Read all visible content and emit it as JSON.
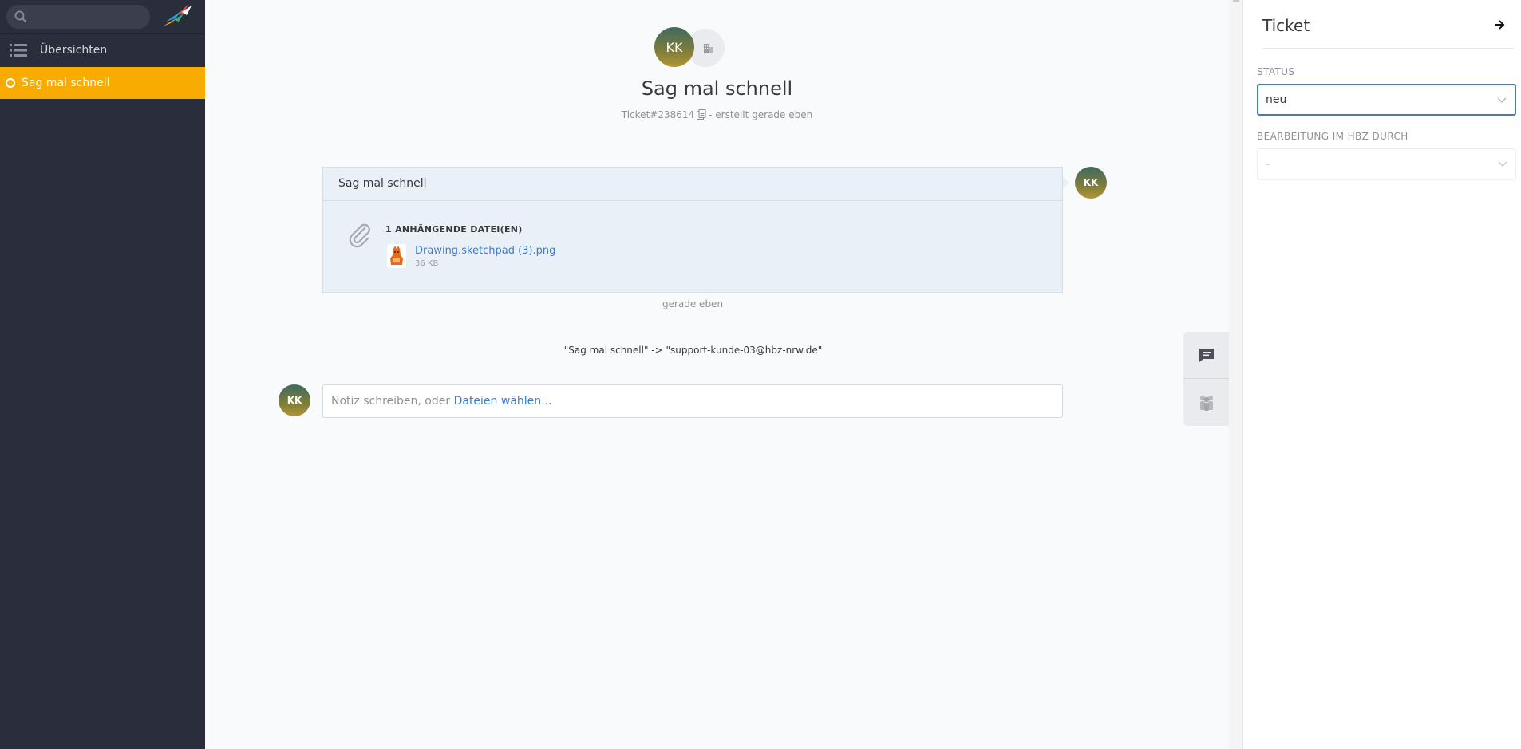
{
  "sidebar": {
    "search": {
      "value": "",
      "placeholder": ""
    },
    "nav": {
      "overviews_label": "Übersichten"
    },
    "open_tab": {
      "label": "Sag mal schnell"
    }
  },
  "ticket": {
    "customer_initials": "KK",
    "title": "Sag mal schnell",
    "number": "Ticket#238614",
    "created": "- erstellt gerade eben"
  },
  "article": {
    "subject": "Sag mal schnell",
    "attachments_heading": "1 ANHÄNGENDE DATEI(EN)",
    "attachment": {
      "name": "Drawing.sketchpad (3).png",
      "size": "36 KB"
    },
    "author_initials": "KK",
    "time": "gerade eben"
  },
  "notification": "\"Sag mal schnell\" -> \"support-kunde-03@hbz-nrw.de\"",
  "note": {
    "author_initials": "KK",
    "placeholder_text": "Notiz schreiben, oder ",
    "files_link": "Dateien wählen..."
  },
  "right_panel": {
    "title": "Ticket",
    "status": {
      "label": "STATUS",
      "value": "neu"
    },
    "assignee": {
      "label": "BEARBEITUNG IM HBZ DURCH",
      "value": "-"
    }
  },
  "colors": {
    "sidebar_bg": "#2a2d3b",
    "active_tab": "#f8ab00",
    "link": "#3c7bd0",
    "article_bg": "#e9f0f7"
  },
  "icons": {
    "search": "search-icon",
    "logo": "zammad-logo-icon",
    "overviews": "list-icon",
    "organization": "building-icon",
    "copy": "copy-icon",
    "attachment": "paperclip-icon",
    "attachment_thumb": "image-thumbnail-icon",
    "chat": "chat-icon",
    "customer": "people-icon",
    "close_panel": "arrow-right-icon",
    "dropdown": "chevron-down-icon"
  }
}
